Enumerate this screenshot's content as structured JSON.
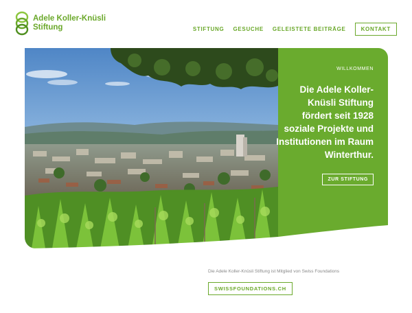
{
  "brand": {
    "name_line1": "Adele Koller-Knüsli",
    "name_line2": "Stiftung",
    "color": "#6aa82a"
  },
  "nav": {
    "items": [
      {
        "label": "STIFTUNG"
      },
      {
        "label": "GESUCHE"
      },
      {
        "label": "GELEISTETE BEITRÄGE"
      }
    ],
    "contact_label": "KONTAKT"
  },
  "hero": {
    "eyebrow": "WILLKOMMEN",
    "headline": "Die Adele Koller-Knüsli Stiftung fördert seit 1928 soziale Projekte und Institutionen im Raum Winterthur.",
    "button_label": "ZUR STIFTUNG",
    "panel_color": "#6aab2e"
  },
  "membership": {
    "text": "Die Adele Koller-Knüsli Stiftung ist Mitglied von Swiss Foundations",
    "button_label": "SWISSFOUNDATIONS.CH"
  }
}
